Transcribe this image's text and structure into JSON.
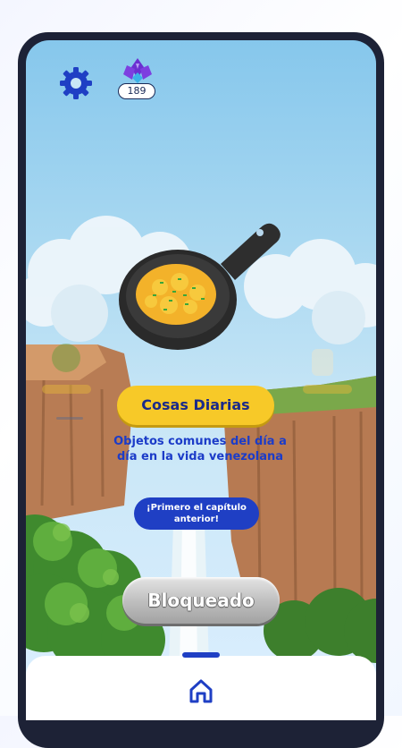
{
  "header": {
    "settings_icon": "gear-icon",
    "gem_icon": "purple-gem-icon",
    "gem_count": "189"
  },
  "chapter": {
    "item_icon": "frying-pan-eggs-icon",
    "title": "Cosas Diarias",
    "description": "Objetos comunes del día a día en la vida venezolana",
    "requirement": "¡Primero el capítulo anterior!",
    "action_label": "Bloqueado",
    "locked": true
  },
  "bottom_nav": {
    "items": [
      {
        "icon": "home-icon",
        "active": true
      }
    ]
  },
  "colors": {
    "accent_blue": "#1f3fc4",
    "accent_yellow": "#f7c928",
    "sky": "#9fd3f0"
  }
}
